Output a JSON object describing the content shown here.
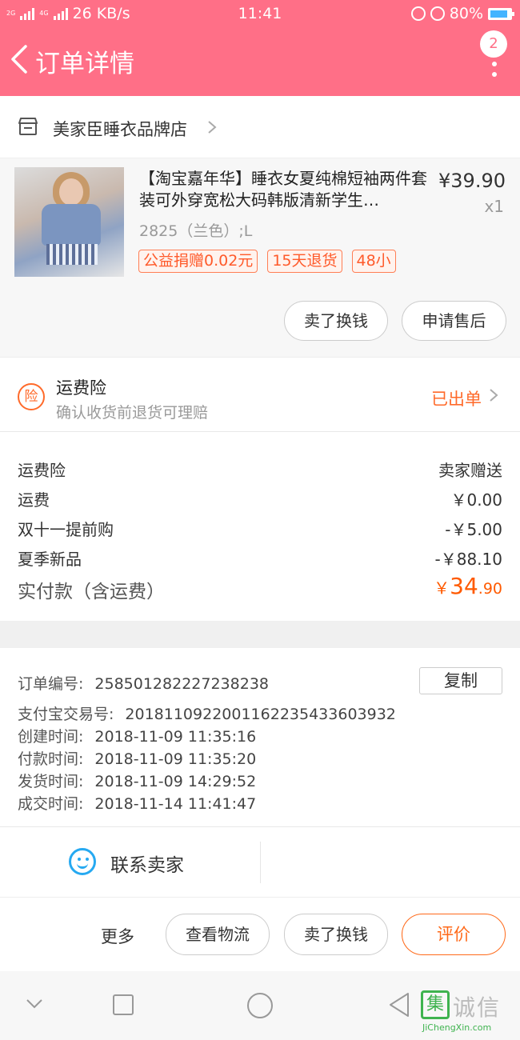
{
  "status_bar": {
    "net_speed": "26 KB/s",
    "time": "11:41",
    "battery": "80%",
    "net_2g": "2G",
    "net_4g": "4G",
    "battery_level": 0.8
  },
  "header": {
    "title": "订单详情",
    "badge": "2"
  },
  "store": {
    "name": "美家臣睡衣品牌店"
  },
  "product": {
    "title": "【淘宝嘉年华】睡衣女夏纯棉短袖两件套装可外穿宽松大码韩版清新学生…",
    "price": "¥39.90",
    "qty": "x1",
    "sku": "2825（兰色）;L",
    "tags": [
      "公益捐赠0.02元",
      "15天退货",
      "48小"
    ],
    "buttons": {
      "resell": "卖了换钱",
      "after_sale": "申请售后"
    }
  },
  "insurance": {
    "icon_text": "险",
    "title": "运费险",
    "subtitle": "确认收货前退货可理赔",
    "status": "已出单"
  },
  "fees": {
    "rows": [
      {
        "label": "运费险",
        "value": "卖家赠送"
      },
      {
        "label": "运费",
        "value": "￥0.00"
      },
      {
        "label": "双十一提前购",
        "value": "-￥5.00"
      },
      {
        "label": "夏季新品",
        "value": "-￥88.10"
      }
    ],
    "total_label": "实付款（含运费）",
    "total_currency": "￥",
    "total_int": "34",
    "total_dec": ".90"
  },
  "order_info": {
    "copy_label": "复制",
    "rows": [
      {
        "label": "订单编号:",
        "value": "258501282227238238"
      },
      {
        "label": "支付宝交易号:",
        "value": "2018110922001162235433603932"
      },
      {
        "label": "创建时间:",
        "value": "2018-11-09 11:35:16"
      },
      {
        "label": "付款时间:",
        "value": "2018-11-09 11:35:20"
      },
      {
        "label": "发货时间:",
        "value": "2018-11-09 14:29:52"
      },
      {
        "label": "成交时间:",
        "value": "2018-11-14 11:41:47"
      }
    ]
  },
  "contact": {
    "label": "联系卖家"
  },
  "actions": {
    "more": "更多",
    "logistics": "查看物流",
    "resell": "卖了换钱",
    "review": "评价"
  },
  "watermark": {
    "logo_char": "集",
    "text": "诚信",
    "url": "JiChengXin.com"
  },
  "colors": {
    "header_bg": "#ff6f87",
    "accent_orange": "#ff5a00",
    "contact_blue": "#26a9f1"
  }
}
